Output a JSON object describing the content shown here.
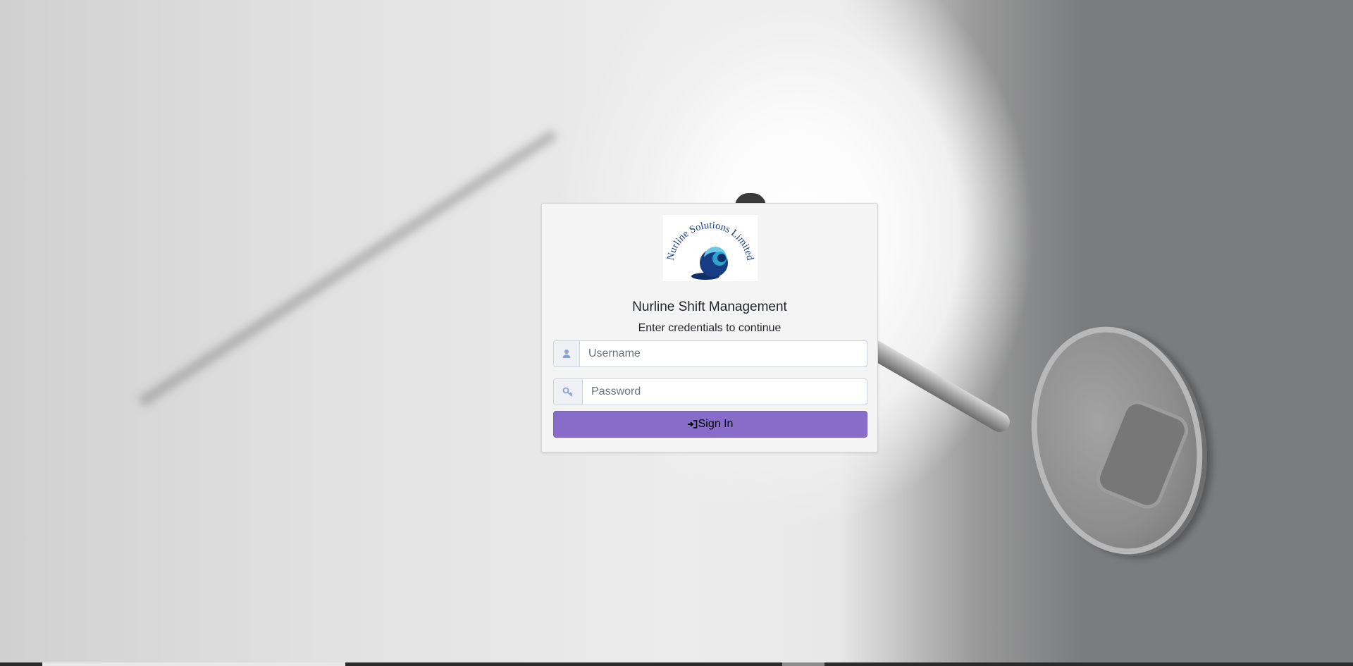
{
  "logo": {
    "text": "Nurline Solutions Limited",
    "icon": "globe-logo-icon"
  },
  "login": {
    "title": "Nurline Shift Management",
    "subtitle": "Enter credentials to continue",
    "username_placeholder": "Username",
    "password_placeholder": "Password",
    "username_icon": "user-icon",
    "password_icon": "key-icon",
    "signin_label": "Sign In",
    "signin_icon": "sign-in-icon"
  },
  "colors": {
    "button": "#876cc9",
    "logo_text": "#1d3f8a",
    "addon_icon": "#8aa0d4"
  }
}
